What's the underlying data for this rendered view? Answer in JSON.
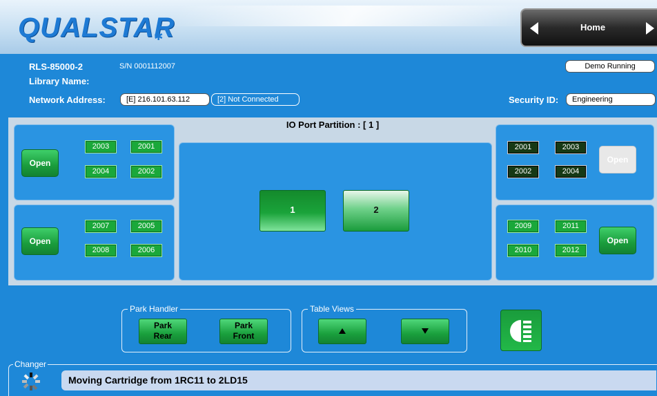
{
  "header": {
    "logo_text": "QUALSTAR",
    "nav_label": "Home",
    "nav_prev_icon": "chevron-left-icon",
    "nav_next_icon": "chevron-right-icon"
  },
  "library": {
    "model": "RLS-85000-2",
    "serial": "S/N 0001112007",
    "library_name_label": "Library Name:",
    "network_label": "Network Address:",
    "network_ip": "[E] 216.101.63.112",
    "network_status": "[2] Not Connected",
    "run_status": "Demo Running",
    "security_label": "Security ID:",
    "security_value": "Engineering"
  },
  "partition": {
    "title": "IO Port Partition : [ 1 ]",
    "ports": [
      {
        "label": "1",
        "selected": true
      },
      {
        "label": "2",
        "selected": false
      }
    ]
  },
  "magazines": {
    "left_top": {
      "open_label": "Open",
      "slots": [
        "2003",
        "2001",
        "2004",
        "2002"
      ],
      "style": "green",
      "open_enabled": true
    },
    "left_bottom": {
      "open_label": "Open",
      "slots": [
        "2007",
        "2005",
        "2008",
        "2006"
      ],
      "style": "green",
      "open_enabled": true
    },
    "right_top": {
      "open_label": "Open",
      "slots": [
        "2001",
        "2003",
        "2002",
        "2004"
      ],
      "style": "dark",
      "open_enabled": false
    },
    "right_bottom": {
      "open_label": "Open",
      "slots": [
        "2009",
        "2011",
        "2010",
        "2012"
      ],
      "style": "green",
      "open_enabled": true
    }
  },
  "controls": {
    "park_legend": "Park Handler",
    "park_rear_line1": "Park",
    "park_rear_line2": "Rear",
    "park_front_line1": "Park",
    "park_front_line2": "Front",
    "table_legend": "Table Views",
    "table_up_icon": "triangle-up-icon",
    "table_down_icon": "triangle-down-icon",
    "light_icon": "headlight-icon"
  },
  "changer": {
    "legend": "Changer",
    "status": "Moving Cartridge from 1RC11 to 2LD15",
    "spinner_icon": "loading-spinner-icon"
  },
  "colors": {
    "background": "#1e88d8",
    "accent_green": "#1aa83a",
    "panel_gray": "#c8d8e6"
  }
}
